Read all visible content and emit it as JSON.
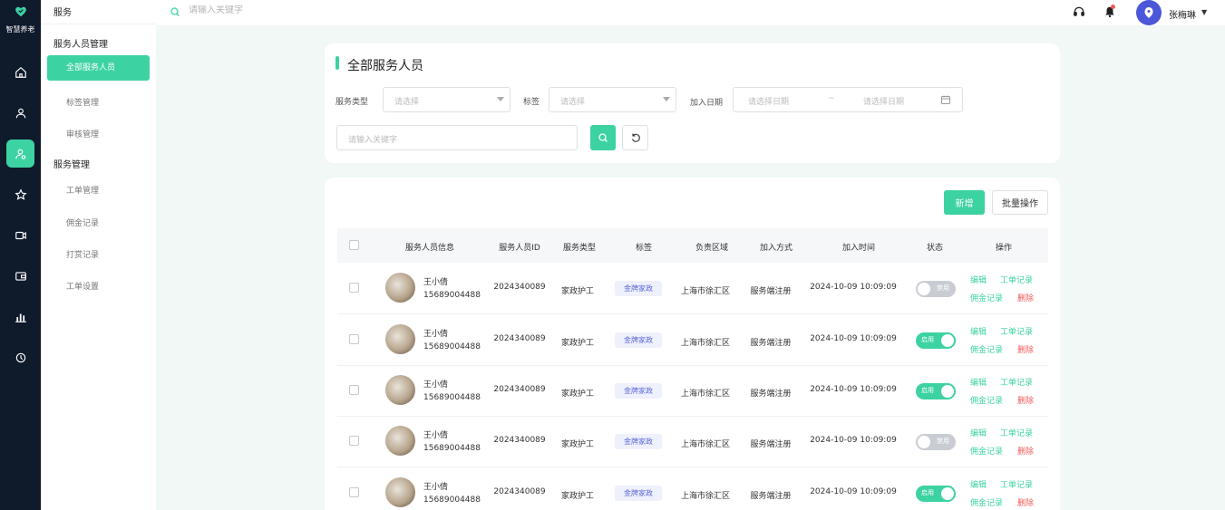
{
  "app": {
    "logo_text": "智慧养老"
  },
  "colors": {
    "accent": "#3dd2a2",
    "rail": "#0f1a2b",
    "danger": "#f25a5a",
    "tag": "#5a67d8"
  },
  "rail_icons": [
    "home-icon",
    "user-icon",
    "service-person-icon",
    "star-icon",
    "video-icon",
    "wallet-icon",
    "chart-icon",
    "clock-icon"
  ],
  "subnav": {
    "head": "服务",
    "section1": "服务人员管理",
    "items1": [
      "全部服务人员",
      "标签管理",
      "审核管理"
    ],
    "section2": "服务管理",
    "items2": [
      "工单管理",
      "佣金记录",
      "打赏记录",
      "工单设置"
    ]
  },
  "topbar": {
    "search_placeholder": "请输入关键字",
    "user_name": "张梅琳"
  },
  "filter": {
    "title": "全部服务人员",
    "type_label": "服务类型",
    "type_placeholder": "请选择",
    "tag_label": "标签",
    "tag_placeholder": "请选择",
    "date_label": "加入日期",
    "date_start_placeholder": "请选择日期",
    "date_sep": "~",
    "date_end_placeholder": "请选择日期",
    "keyword_placeholder": "请输入关键字"
  },
  "toolbar": {
    "add_label": "新增",
    "batch_label": "批量操作"
  },
  "table": {
    "headers": [
      "服务人员信息",
      "服务人员ID",
      "服务类型",
      "标签",
      "负责区域",
      "加入方式",
      "加入时间",
      "状态",
      "操作"
    ],
    "rows": [
      {
        "name": "王小倩",
        "phone": "15689004488",
        "id": "2024340089",
        "type": "家政护工",
        "tag": "金牌家政",
        "area": "上海市徐汇区",
        "join": "服务端注册",
        "time": "2024-10-09 10:09:09",
        "status": "禁用",
        "on": false
      },
      {
        "name": "王小倩",
        "phone": "15689004488",
        "id": "2024340089",
        "type": "家政护工",
        "tag": "金牌家政",
        "area": "上海市徐汇区",
        "join": "服务端注册",
        "time": "2024-10-09 10:09:09",
        "status": "启用",
        "on": true
      },
      {
        "name": "王小倩",
        "phone": "15689004488",
        "id": "2024340089",
        "type": "家政护工",
        "tag": "金牌家政",
        "area": "上海市徐汇区",
        "join": "服务端注册",
        "time": "2024-10-09 10:09:09",
        "status": "启用",
        "on": true
      },
      {
        "name": "王小倩",
        "phone": "15689004488",
        "id": "2024340089",
        "type": "家政护工",
        "tag": "金牌家政",
        "area": "上海市徐汇区",
        "join": "服务端注册",
        "time": "2024-10-09 10:09:09",
        "status": "禁用",
        "on": false
      },
      {
        "name": "王小倩",
        "phone": "15689004488",
        "id": "2024340089",
        "type": "家政护工",
        "tag": "金牌家政",
        "area": "上海市徐汇区",
        "join": "服务端注册",
        "time": "2024-10-09 10:09:09",
        "status": "启用",
        "on": true
      }
    ],
    "actions": {
      "edit": "编辑",
      "orders": "工单记录",
      "commission": "佣金记录",
      "delete": "删除"
    }
  }
}
